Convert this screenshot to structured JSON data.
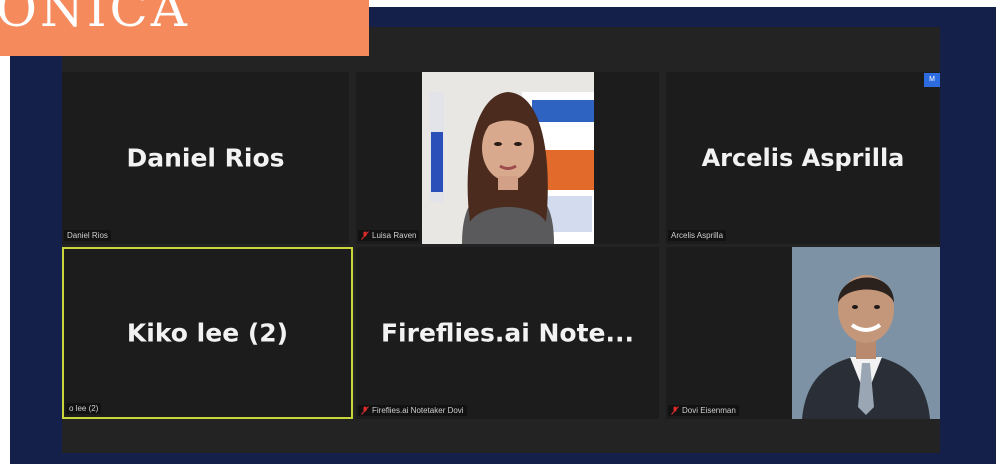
{
  "banner": {
    "text": "ONICA",
    "color": "#f58b5c"
  },
  "colors": {
    "frame": "#14204a",
    "window": "#232323",
    "active_speaker": "#c8d63a"
  },
  "participants": [
    {
      "display_name": "Daniel Rios",
      "tag": "Daniel Rios",
      "muted": false,
      "video": false
    },
    {
      "display_name": "",
      "tag": "Luisa Raven",
      "muted": true,
      "video": true
    },
    {
      "display_name": "Arcelis Asprilla",
      "tag": "Arcelis Asprilla",
      "muted": false,
      "video": false,
      "badge": "M"
    },
    {
      "display_name": "Kiko lee (2)",
      "tag": "o lee (2)",
      "muted": false,
      "video": false,
      "active_speaker": true
    },
    {
      "display_name": "Fireflies.ai  Note...",
      "tag": "Fireflies.ai Notetaker Dovi",
      "muted": true,
      "video": false
    },
    {
      "display_name": "",
      "tag": "Dovi Eisenman",
      "muted": true,
      "video": true
    }
  ],
  "icons": {
    "mute": "mic-off-icon"
  }
}
